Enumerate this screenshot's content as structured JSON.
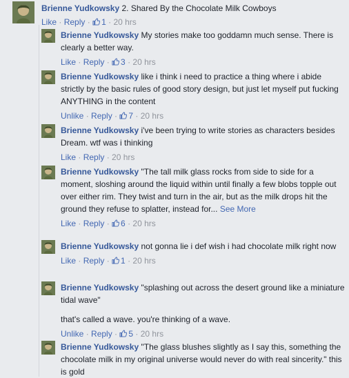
{
  "main_comment": {
    "author": "Brienne Yudkowsky",
    "text": "2. Shared By the Chocolate Milk Cowboys",
    "like_label": "Like",
    "reply_label": "Reply",
    "like_count": "1",
    "time": "20 hrs"
  },
  "replies": [
    {
      "author": "Brienne Yudkowsky",
      "text": "My stories make too goddamn much sense. There is clearly a better way.",
      "like_label": "Like",
      "reply_label": "Reply",
      "like_count": "3",
      "time": "20 hrs"
    },
    {
      "author": "Brienne Yudkowsky",
      "text": "like i think i need to practice a thing where i abide strictly by the basic rules of good story design, but just let myself put fucking ANYTHING in the content",
      "like_label": "Unlike",
      "reply_label": "Reply",
      "like_count": "7",
      "time": "20 hrs"
    },
    {
      "author": "Brienne Yudkowsky",
      "text": "i've been trying to write stories as characters besides Dream. wtf was i thinking",
      "like_label": "Like",
      "reply_label": "Reply",
      "like_count": "",
      "time": "20 hrs"
    },
    {
      "author": "Brienne Yudkowsky",
      "text": "\"The tall milk glass rocks from side to side for a moment, sloshing around the liquid within until finally a few blobs topple out over either rim. They twist and turn in the air, but as the milk drops hit the ground they refuse to splatter, instead for...",
      "see_more": "See More",
      "like_label": "Like",
      "reply_label": "Reply",
      "like_count": "6",
      "time": "20 hrs"
    },
    {
      "author": "Brienne Yudkowsky",
      "text": "not gonna lie i def wish i had chocolate milk right now",
      "like_label": "Like",
      "reply_label": "Reply",
      "like_count": "1",
      "time": "20 hrs"
    },
    {
      "author": "Brienne Yudkowsky",
      "text": "\"splashing out across the desert ground like a miniature tidal wave\"",
      "text2": "that's called a wave. you're thinking of a wave.",
      "like_label": "Unlike",
      "reply_label": "Reply",
      "like_count": "5",
      "time": "20 hrs"
    },
    {
      "author": "Brienne Yudkowsky",
      "text": "\"The glass blushes slightly as I say this, something the chocolate milk in my original universe would never do with real sincerity.\" this is gold"
    }
  ],
  "colors": {
    "background": "#e9ebee",
    "name": "#365899",
    "link": "#4267b2",
    "meta": "#90949c"
  },
  "icons": {
    "like": "thumbs-up-icon",
    "avatar": "profile-photo"
  }
}
